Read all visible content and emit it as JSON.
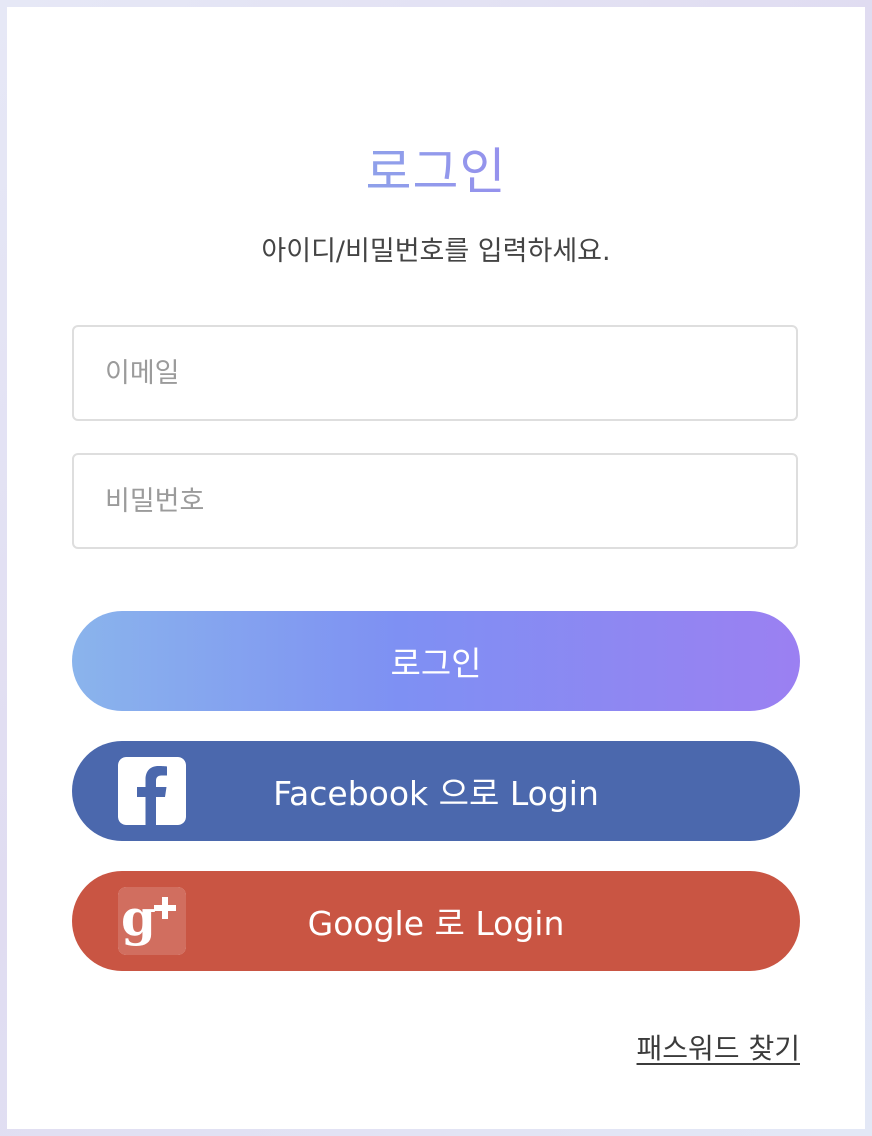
{
  "header": {
    "title": "로그인",
    "subtitle": "아이디/비밀번호를 입력하세요."
  },
  "form": {
    "email_placeholder": "이메일",
    "email_value": "",
    "password_placeholder": "비밀번호",
    "password_value": ""
  },
  "buttons": {
    "login_label": "로그인",
    "facebook_label": "Facebook 으로 Login",
    "google_label": "Google 로 Login"
  },
  "icons": {
    "facebook": "facebook-icon",
    "google": "google-plus-icon"
  },
  "links": {
    "forgot_password": "패스워드 찾기"
  },
  "colors": {
    "facebook": "#4b68ad",
    "google": "#c95543",
    "login_gradient_start": "#8ab4ec",
    "login_gradient_end": "#9b80f2"
  }
}
